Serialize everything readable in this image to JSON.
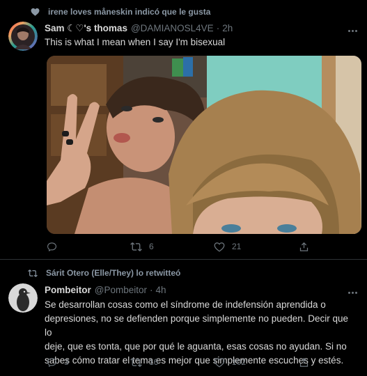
{
  "tweet1": {
    "social_context": "irene loves måneskin indicó que le gusta",
    "author_name": "Sam ☾♡'s thomas",
    "handle": "@DAMIANOSL4VE",
    "time": "2h",
    "text": "This is what I mean when I say I'm bisexual",
    "media": "photo-two-people-selfie",
    "actions": {
      "reply": "",
      "retweets": "6",
      "likes": "21"
    }
  },
  "tweet2": {
    "social_context": "Sárit Otero (Elle/They) lo retwitteó",
    "author_name": "Pombeitor",
    "handle": "@Pombeitor",
    "time": "4h",
    "text_lines": [
      "Se desarrollan cosas como el síndrome de indefensión aprendida o",
      "depresiones, no se defienden porque simplemente no pueden. Decir que lo",
      "deje, que es tonta, que por qué le aguanta, esas cosas no ayudan. Si no",
      "sabes cómo tratar el tema es mejor que simplemente escuches y estés."
    ],
    "actions": {
      "replies": "3",
      "retweets": "16",
      "likes": "102"
    }
  },
  "colors": {
    "background": "#000000",
    "text": "#d9d9d9",
    "muted": "#6e767d",
    "divider": "#2f3336"
  }
}
